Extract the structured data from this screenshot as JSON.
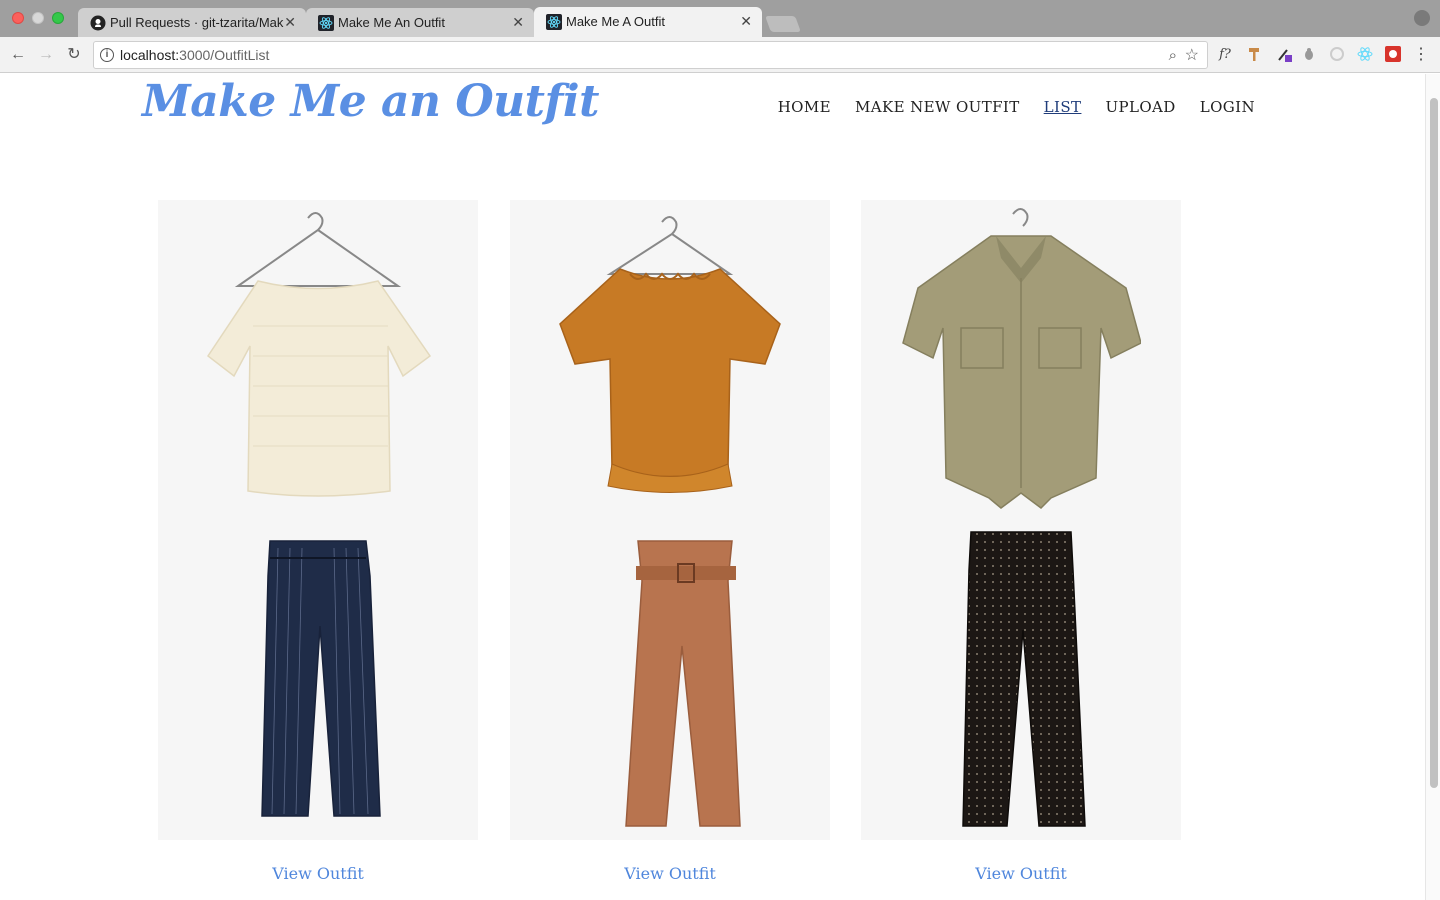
{
  "browser": {
    "tabs": [
      {
        "label": "Pull Requests · git-tzarita/Mak",
        "icon": "github-icon"
      },
      {
        "label": "Make Me An Outfit",
        "icon": "react-icon"
      },
      {
        "label": "Make Me A Outfit",
        "icon": "react-icon"
      }
    ],
    "url_host": "localhost:",
    "url_path": "3000/OutfitList",
    "extensions": [
      "f?"
    ]
  },
  "site": {
    "brand": "Make Me an Outfit",
    "brand_color": "#5a8fe3",
    "nav": [
      {
        "label": "HOME"
      },
      {
        "label": "MAKE NEW OUTFIT"
      },
      {
        "label": "LIST"
      },
      {
        "label": "UPLOAD"
      },
      {
        "label": "LOGIN"
      }
    ]
  },
  "outfits": [
    {
      "top": "cream off-shoulder top",
      "bottom": "navy pinstripe pants",
      "link": "View Outfit"
    },
    {
      "top": "orange ruffle blouse",
      "bottom": "rust paperbag-waist pants",
      "link": "View Outfit"
    },
    {
      "top": "khaki tie-front shirt",
      "bottom": "black dotted pants",
      "link": "View Outfit"
    }
  ]
}
